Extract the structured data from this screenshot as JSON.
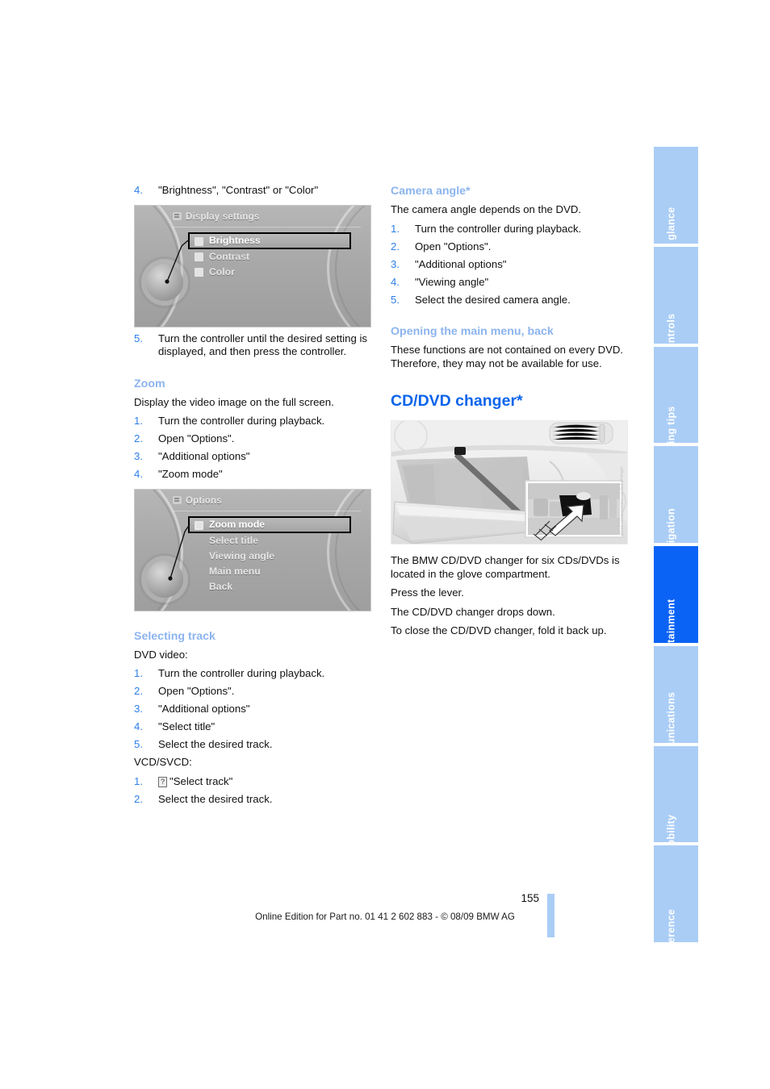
{
  "document": {
    "page_number": "155",
    "footer": "Online Edition for Part no. 01 41 2 602 883 - © 08/09 BMW AG"
  },
  "tabs": [
    {
      "label": "At a glance",
      "active": false
    },
    {
      "label": "Controls",
      "active": false
    },
    {
      "label": "Driving tips",
      "active": false
    },
    {
      "label": "Navigation",
      "active": false
    },
    {
      "label": "Entertainment",
      "active": true
    },
    {
      "label": "Communications",
      "active": false
    },
    {
      "label": "Mobility",
      "active": false
    },
    {
      "label": "Reference",
      "active": false
    }
  ],
  "colors": {
    "accent_heading": "#0a64eb",
    "sub_heading": "#8cb4ef",
    "list_number": "#2e7fe8",
    "tab_inactive": "#aacdf6",
    "tab_active": "#0b63f6"
  },
  "left_column": {
    "step4": {
      "num": "4.",
      "text": "\"Brightness\", \"Contrast\" or \"Color\""
    },
    "display_settings_screen": {
      "title": "Display settings",
      "items": [
        {
          "label": "Brightness",
          "icon": "brightness-icon",
          "selected": true
        },
        {
          "label": "Contrast",
          "icon": "contrast-icon",
          "selected": false
        },
        {
          "label": "Color",
          "icon": "color-icon",
          "selected": false
        }
      ]
    },
    "step5": {
      "num": "5.",
      "text": "Turn the controller until the desired setting is displayed, and then press the controller."
    },
    "zoom_section": {
      "heading": "Zoom",
      "intro": "Display the video image on the full screen.",
      "steps": [
        {
          "num": "1.",
          "text": "Turn the controller during playback."
        },
        {
          "num": "2.",
          "text": "Open \"Options\"."
        },
        {
          "num": "3.",
          "text": "\"Additional options\""
        },
        {
          "num": "4.",
          "text": "\"Zoom mode\""
        }
      ]
    },
    "options_screen": {
      "title": "Options",
      "items": [
        {
          "label": "Zoom mode",
          "icon": "square-icon",
          "selected": true
        },
        {
          "label": "Select title",
          "icon": "",
          "selected": false
        },
        {
          "label": "Viewing angle",
          "icon": "",
          "selected": false
        },
        {
          "label": "Main menu",
          "icon": "",
          "selected": false
        },
        {
          "label": "Back",
          "icon": "",
          "selected": false
        }
      ]
    },
    "selecting_track": {
      "heading": "Selecting track",
      "dvd_label": "DVD video:",
      "dvd_steps": [
        {
          "num": "1.",
          "text": "Turn the controller during playback."
        },
        {
          "num": "2.",
          "text": "Open \"Options\"."
        },
        {
          "num": "3.",
          "text": "\"Additional options\""
        },
        {
          "num": "4.",
          "text": "\"Select title\""
        },
        {
          "num": "5.",
          "text": "Select the desired track."
        }
      ],
      "vcd_label": "VCD/SVCD:",
      "vcd_steps": [
        {
          "num": "1.",
          "glyph": "?",
          "text": "\"Select track\""
        },
        {
          "num": "2.",
          "glyph": "",
          "text": "Select the desired track."
        }
      ]
    }
  },
  "right_column": {
    "camera_angle": {
      "heading": "Camera angle*",
      "intro": "The camera angle depends on the DVD.",
      "steps": [
        {
          "num": "1.",
          "text": "Turn the controller during playback."
        },
        {
          "num": "2.",
          "text": "Open \"Options\"."
        },
        {
          "num": "3.",
          "text": "\"Additional options\""
        },
        {
          "num": "4.",
          "text": "\"Viewing angle\""
        },
        {
          "num": "5.",
          "text": "Select the desired camera angle."
        }
      ]
    },
    "main_menu_back": {
      "heading": "Opening the main menu, back",
      "text": "These functions are not contained on every DVD. Therefore, they may not be available for use."
    },
    "cd_dvd_changer": {
      "heading": "CD/DVD changer*",
      "image_caption": "glove-compartment-cd-dvd-changer",
      "paragraphs": [
        "The BMW CD/DVD changer for six CDs/DVDs is located in the glove compartment.",
        "Press the lever.",
        "The CD/DVD changer drops down.",
        "To close the CD/DVD changer, fold it back up."
      ]
    }
  }
}
